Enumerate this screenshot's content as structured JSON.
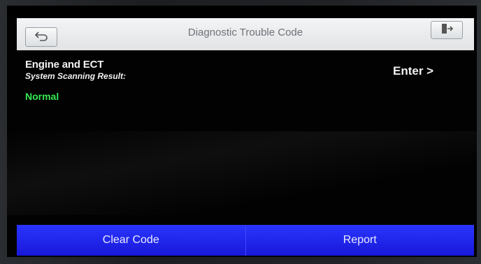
{
  "header": {
    "title": "Diagnostic Trouble Code",
    "back_icon": "back-arrow-icon",
    "exit_icon": "exit-door-icon"
  },
  "content": {
    "system_name": "Engine and ECT",
    "scan_label": "System Scanning Result:",
    "scan_result": "Normal",
    "enter_label": "Enter >"
  },
  "footer": {
    "clear_code_label": "Clear Code",
    "report_label": "Report"
  },
  "colors": {
    "result_green": "#35e84f",
    "button_blue": "#1e25f0"
  }
}
